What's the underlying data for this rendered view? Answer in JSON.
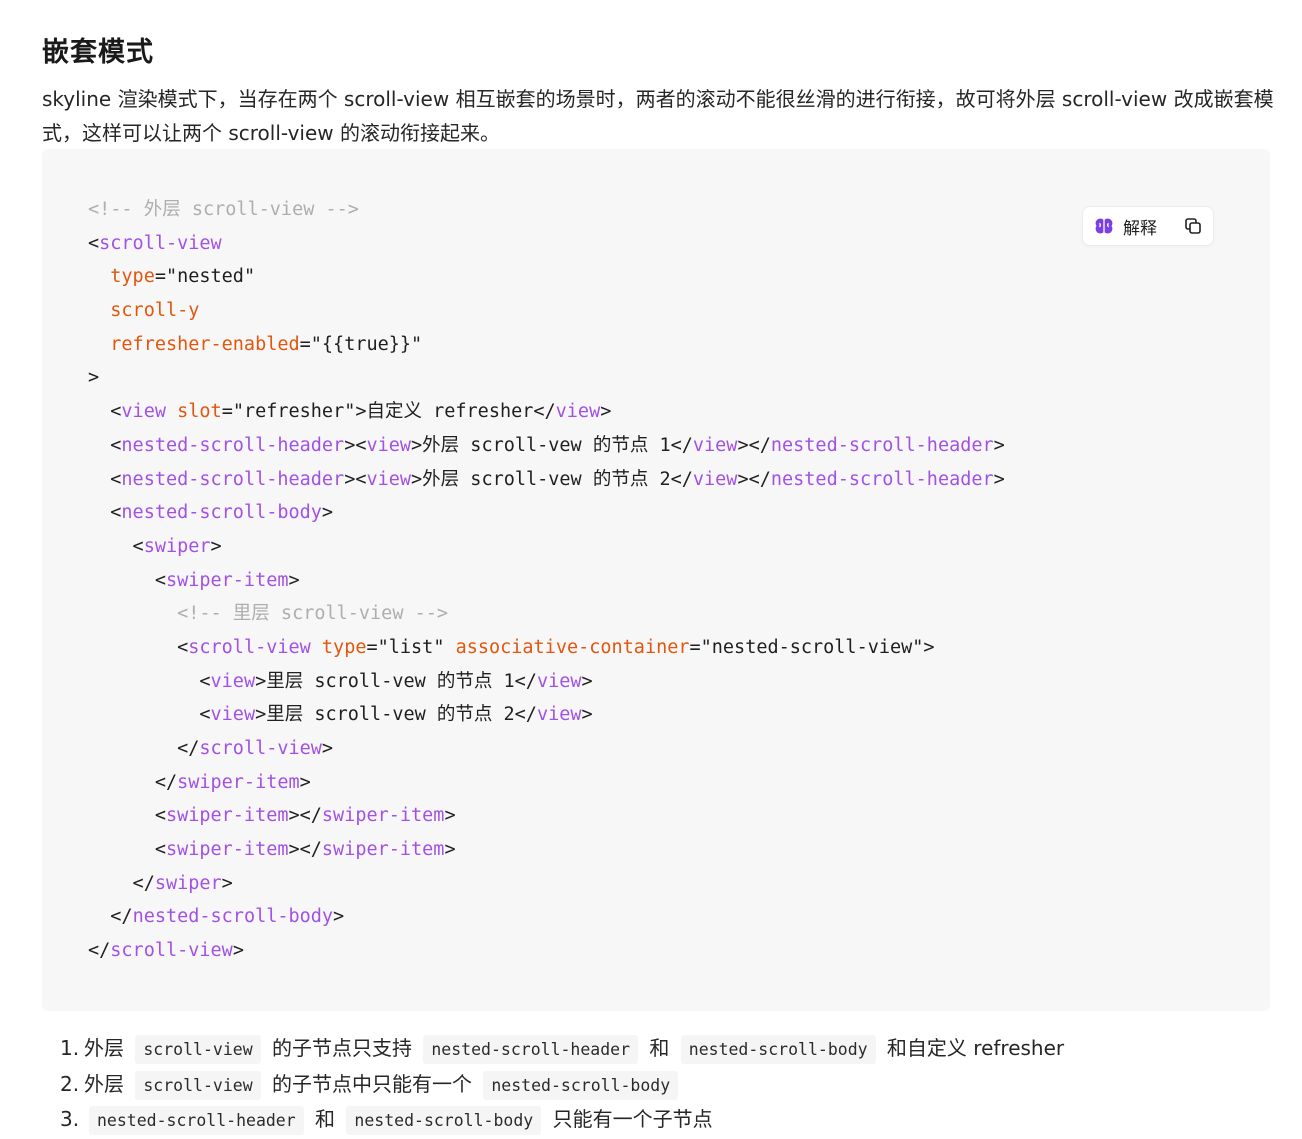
{
  "heading": "嵌套模式",
  "intro": "skyline 渲染模式下，当存在两个 scroll-view 相互嵌套的场景时，两者的滚动不能很丝滑的进行衔接，故可将外层 scroll-view 改成嵌套模式，这样可以让两个 scroll-view 的滚动衔接起来。",
  "toolbar": {
    "explain_label": "解释",
    "explain_icon": "brain-icon",
    "copy_icon": "copy-icon",
    "accent": "#7b3fe4"
  },
  "colors": {
    "tag": "#a251e6",
    "attr": "#e2560d",
    "comment": "#aeaeae",
    "text": "#1f1f1f"
  },
  "code_lines": [
    [
      {
        "k": "c",
        "v": "<!-- 外层 scroll-view -->"
      }
    ],
    [
      {
        "k": "p",
        "v": "<"
      },
      {
        "k": "t",
        "v": "scroll-view"
      }
    ],
    [
      {
        "k": "p",
        "v": "  "
      },
      {
        "k": "a",
        "v": "type"
      },
      {
        "k": "p",
        "v": "="
      },
      {
        "k": "s",
        "v": "\"nested\""
      }
    ],
    [
      {
        "k": "p",
        "v": "  "
      },
      {
        "k": "a",
        "v": "scroll-y"
      }
    ],
    [
      {
        "k": "p",
        "v": "  "
      },
      {
        "k": "a",
        "v": "refresher-enabled"
      },
      {
        "k": "p",
        "v": "="
      },
      {
        "k": "s",
        "v": "\"{{true}}\""
      }
    ],
    [
      {
        "k": "p",
        "v": ">"
      }
    ],
    [
      {
        "k": "p",
        "v": "  <"
      },
      {
        "k": "t",
        "v": "view"
      },
      {
        "k": "p",
        "v": " "
      },
      {
        "k": "a",
        "v": "slot"
      },
      {
        "k": "p",
        "v": "="
      },
      {
        "k": "s",
        "v": "\"refresher\""
      },
      {
        "k": "p",
        "v": ">自定义 refresher</"
      },
      {
        "k": "t",
        "v": "view"
      },
      {
        "k": "p",
        "v": ">"
      }
    ],
    [
      {
        "k": "p",
        "v": "  <"
      },
      {
        "k": "t",
        "v": "nested-scroll-header"
      },
      {
        "k": "p",
        "v": "><"
      },
      {
        "k": "t",
        "v": "view"
      },
      {
        "k": "p",
        "v": ">外层 scroll-vew 的节点 1</"
      },
      {
        "k": "t",
        "v": "view"
      },
      {
        "k": "p",
        "v": "></"
      },
      {
        "k": "t",
        "v": "nested-scroll-header"
      },
      {
        "k": "p",
        "v": ">"
      }
    ],
    [
      {
        "k": "p",
        "v": "  <"
      },
      {
        "k": "t",
        "v": "nested-scroll-header"
      },
      {
        "k": "p",
        "v": "><"
      },
      {
        "k": "t",
        "v": "view"
      },
      {
        "k": "p",
        "v": ">外层 scroll-vew 的节点 2</"
      },
      {
        "k": "t",
        "v": "view"
      },
      {
        "k": "p",
        "v": "></"
      },
      {
        "k": "t",
        "v": "nested-scroll-header"
      },
      {
        "k": "p",
        "v": ">"
      }
    ],
    [
      {
        "k": "p",
        "v": "  <"
      },
      {
        "k": "t",
        "v": "nested-scroll-body"
      },
      {
        "k": "p",
        "v": ">"
      }
    ],
    [
      {
        "k": "p",
        "v": "    <"
      },
      {
        "k": "t",
        "v": "swiper"
      },
      {
        "k": "p",
        "v": ">"
      }
    ],
    [
      {
        "k": "p",
        "v": "      <"
      },
      {
        "k": "t",
        "v": "swiper-item"
      },
      {
        "k": "p",
        "v": ">"
      }
    ],
    [
      {
        "k": "p",
        "v": "        "
      },
      {
        "k": "c",
        "v": "<!-- 里层 scroll-view -->"
      }
    ],
    [
      {
        "k": "p",
        "v": "        <"
      },
      {
        "k": "t",
        "v": "scroll-view"
      },
      {
        "k": "p",
        "v": " "
      },
      {
        "k": "a",
        "v": "type"
      },
      {
        "k": "p",
        "v": "="
      },
      {
        "k": "s",
        "v": "\"list\""
      },
      {
        "k": "p",
        "v": " "
      },
      {
        "k": "a",
        "v": "associative-container"
      },
      {
        "k": "p",
        "v": "="
      },
      {
        "k": "s",
        "v": "\"nested-scroll-view\""
      },
      {
        "k": "p",
        "v": ">"
      }
    ],
    [
      {
        "k": "p",
        "v": "          <"
      },
      {
        "k": "t",
        "v": "view"
      },
      {
        "k": "p",
        "v": ">里层 scroll-vew 的节点 1</"
      },
      {
        "k": "t",
        "v": "view"
      },
      {
        "k": "p",
        "v": ">"
      }
    ],
    [
      {
        "k": "p",
        "v": "          <"
      },
      {
        "k": "t",
        "v": "view"
      },
      {
        "k": "p",
        "v": ">里层 scroll-vew 的节点 2</"
      },
      {
        "k": "t",
        "v": "view"
      },
      {
        "k": "p",
        "v": ">"
      }
    ],
    [
      {
        "k": "p",
        "v": "        </"
      },
      {
        "k": "t",
        "v": "scroll-view"
      },
      {
        "k": "p",
        "v": ">"
      }
    ],
    [
      {
        "k": "p",
        "v": "      </"
      },
      {
        "k": "t",
        "v": "swiper-item"
      },
      {
        "k": "p",
        "v": ">"
      }
    ],
    [
      {
        "k": "p",
        "v": "      <"
      },
      {
        "k": "t",
        "v": "swiper-item"
      },
      {
        "k": "p",
        "v": "></"
      },
      {
        "k": "t",
        "v": "swiper-item"
      },
      {
        "k": "p",
        "v": ">"
      }
    ],
    [
      {
        "k": "p",
        "v": "      <"
      },
      {
        "k": "t",
        "v": "swiper-item"
      },
      {
        "k": "p",
        "v": "></"
      },
      {
        "k": "t",
        "v": "swiper-item"
      },
      {
        "k": "p",
        "v": ">"
      }
    ],
    [
      {
        "k": "p",
        "v": "    </"
      },
      {
        "k": "t",
        "v": "swiper"
      },
      {
        "k": "p",
        "v": ">"
      }
    ],
    [
      {
        "k": "p",
        "v": "  </"
      },
      {
        "k": "t",
        "v": "nested-scroll-body"
      },
      {
        "k": "p",
        "v": ">"
      }
    ],
    [
      {
        "k": "p",
        "v": "</"
      },
      {
        "k": "t",
        "v": "scroll-view"
      },
      {
        "k": "p",
        "v": ">"
      }
    ]
  ],
  "notes": [
    {
      "num": "1.",
      "parts": [
        {
          "k": "text",
          "v": "外层 "
        },
        {
          "k": "code",
          "v": "scroll-view"
        },
        {
          "k": "text",
          "v": " 的子节点只支持 "
        },
        {
          "k": "code",
          "v": "nested-scroll-header"
        },
        {
          "k": "text",
          "v": " 和 "
        },
        {
          "k": "code",
          "v": "nested-scroll-body"
        },
        {
          "k": "text",
          "v": " 和自定义 refresher"
        }
      ]
    },
    {
      "num": "2.",
      "parts": [
        {
          "k": "text",
          "v": "外层 "
        },
        {
          "k": "code",
          "v": "scroll-view"
        },
        {
          "k": "text",
          "v": " 的子节点中只能有一个 "
        },
        {
          "k": "code",
          "v": "nested-scroll-body"
        }
      ]
    },
    {
      "num": "3.",
      "parts": [
        {
          "k": "code",
          "v": "nested-scroll-header"
        },
        {
          "k": "text",
          "v": " 和 "
        },
        {
          "k": "code",
          "v": "nested-scroll-body"
        },
        {
          "k": "text",
          "v": " 只能有一个子节点"
        }
      ]
    }
  ]
}
